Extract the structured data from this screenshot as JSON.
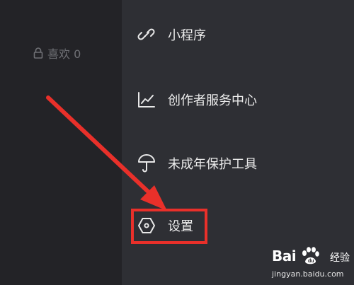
{
  "likes": {
    "label": "喜欢 0",
    "icon": "lock-icon"
  },
  "menu": {
    "items": [
      {
        "label": "小程序",
        "icon": "mini-program-link-icon"
      },
      {
        "label": "创作者服务中心",
        "icon": "chart-line-icon"
      },
      {
        "label": "未成年保护工具",
        "icon": "umbrella-icon"
      },
      {
        "label": "设置",
        "icon": "hexagon-settings-icon"
      }
    ]
  },
  "annotation": {
    "color": "#e9302a",
    "target": "设置"
  },
  "watermark": {
    "brand": "Bai",
    "brand_suffix": "du",
    "sub": "经验",
    "url": "jingyan.baidu.com"
  },
  "colors": {
    "background_left": "#232327",
    "drawer": "#2e2f34",
    "text": "#ececec",
    "accent_red": "#e9302a"
  }
}
